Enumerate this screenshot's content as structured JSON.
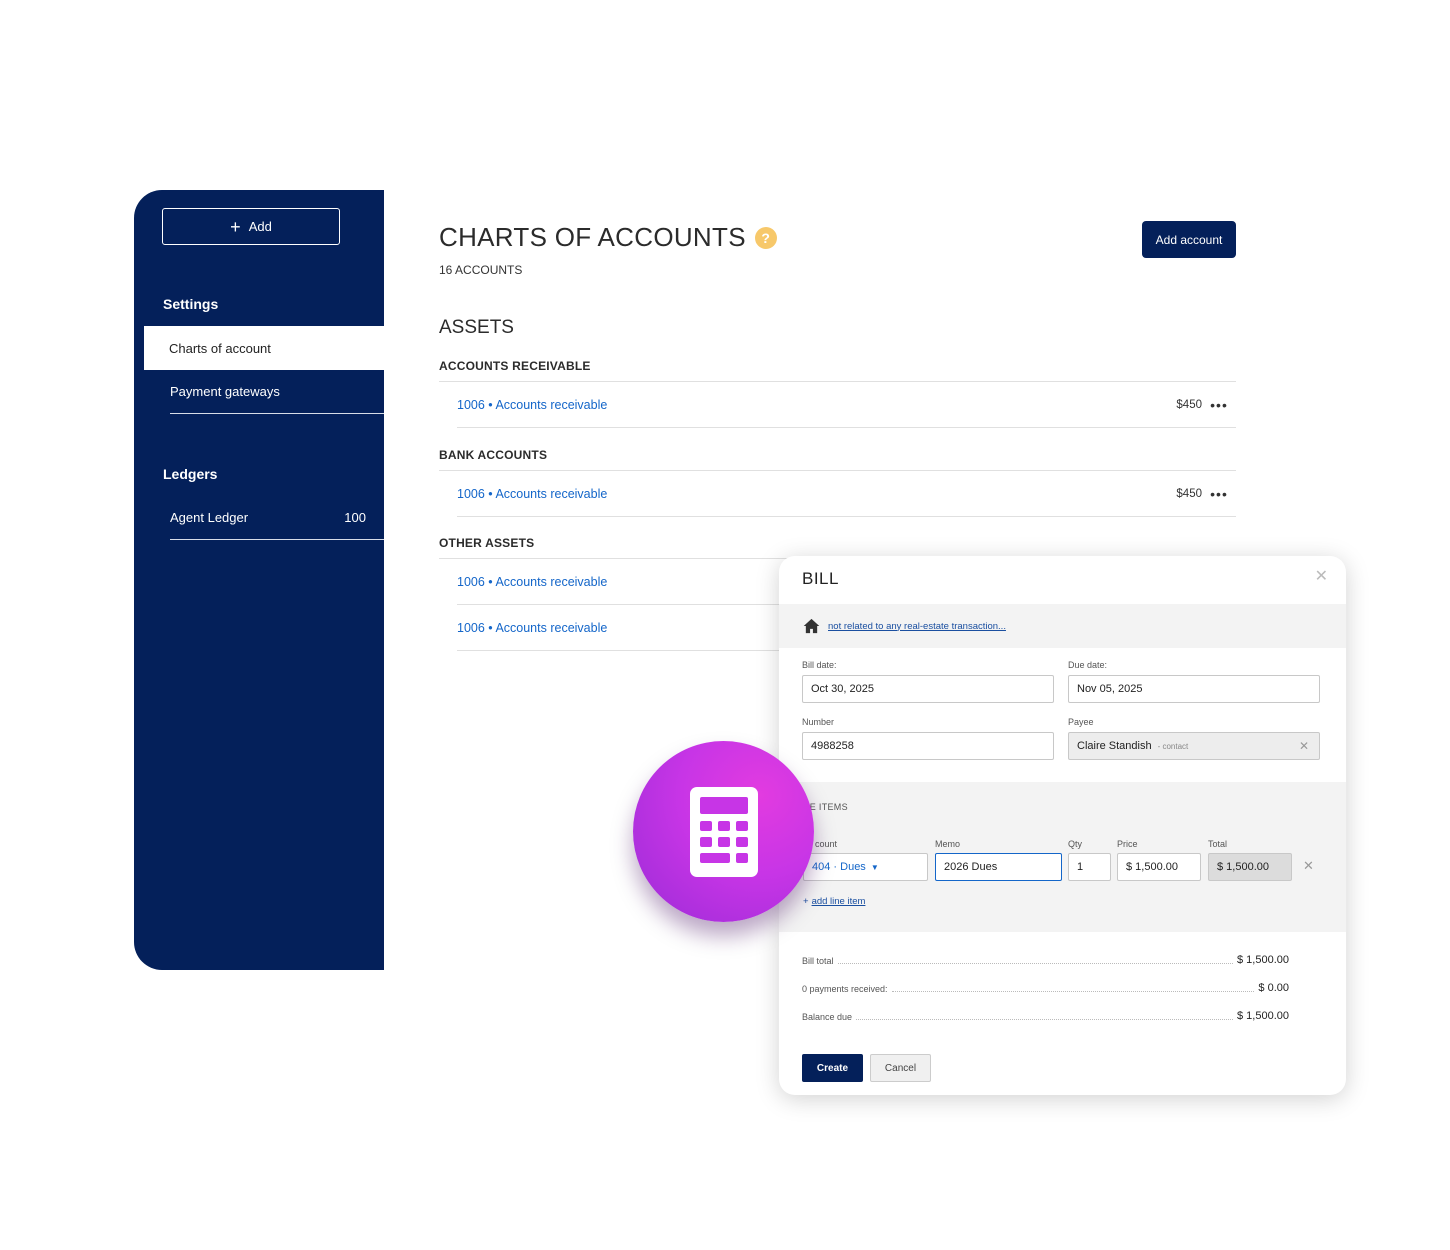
{
  "sidebar": {
    "add_label": "Add",
    "settings_heading": "Settings",
    "settings_items": [
      {
        "label": "Charts of account"
      },
      {
        "label": "Payment gateways"
      }
    ],
    "ledgers_heading": "Ledgers",
    "ledger_items": [
      {
        "label": "Agent Ledger",
        "count": "100"
      }
    ]
  },
  "main": {
    "title": "CHARTS OF ACCOUNTS",
    "help_glyph": "?",
    "account_count": "16 ACCOUNTS",
    "add_account_label": "Add account",
    "section_title": "ASSETS",
    "groups": [
      {
        "title": "ACCOUNTS RECEIVABLE",
        "rows": [
          {
            "label": "1006 • Accounts receivable",
            "amount": "$450"
          }
        ]
      },
      {
        "title": "BANK ACCOUNTS",
        "rows": [
          {
            "label": "1006 • Accounts receivable",
            "amount": "$450"
          }
        ]
      },
      {
        "title": "OTHER ASSETS",
        "rows": [
          {
            "label": "1006 • Accounts receivable",
            "amount": ""
          },
          {
            "label": "1006 • Accounts receivable",
            "amount": ""
          }
        ]
      }
    ],
    "more_glyph": "•••"
  },
  "bill": {
    "title": "BILL",
    "transaction_link": "not related to any real-estate transaction...",
    "bill_date_label": "Bill date:",
    "bill_date_value": "Oct 30, 2025",
    "due_date_label": "Due date:",
    "due_date_value": "Nov 05, 2025",
    "number_label": "Number",
    "number_value": "4988258",
    "payee_label": "Payee",
    "payee_value": "Claire Standish",
    "payee_type": "- contact",
    "line_items_heading": "NE ITEMS",
    "columns": {
      "account": "count",
      "memo": "Memo",
      "qty": "Qty",
      "price": "Price",
      "total": "Total"
    },
    "line_item": {
      "account": "404 · Dues",
      "memo": "2026 Dues",
      "qty": "1",
      "price": "$ 1,500.00",
      "total": "$ 1,500.00"
    },
    "add_line_label": "add line item",
    "summary": [
      {
        "label": "Bill total",
        "value": "$ 1,500.00"
      },
      {
        "label": "0 payments received:",
        "value": "$ 0.00"
      },
      {
        "label": "Balance due",
        "value": "$ 1,500.00"
      }
    ],
    "create_label": "Create",
    "cancel_label": "Cancel"
  },
  "colors": {
    "navy": "#04205a",
    "link": "#1466c9",
    "badge": "#c735e6",
    "help": "#f7c86a"
  },
  "icons": [
    "plus-icon",
    "help-icon",
    "more-icon",
    "close-icon",
    "house-icon",
    "caret-down-icon",
    "calculator-icon"
  ]
}
